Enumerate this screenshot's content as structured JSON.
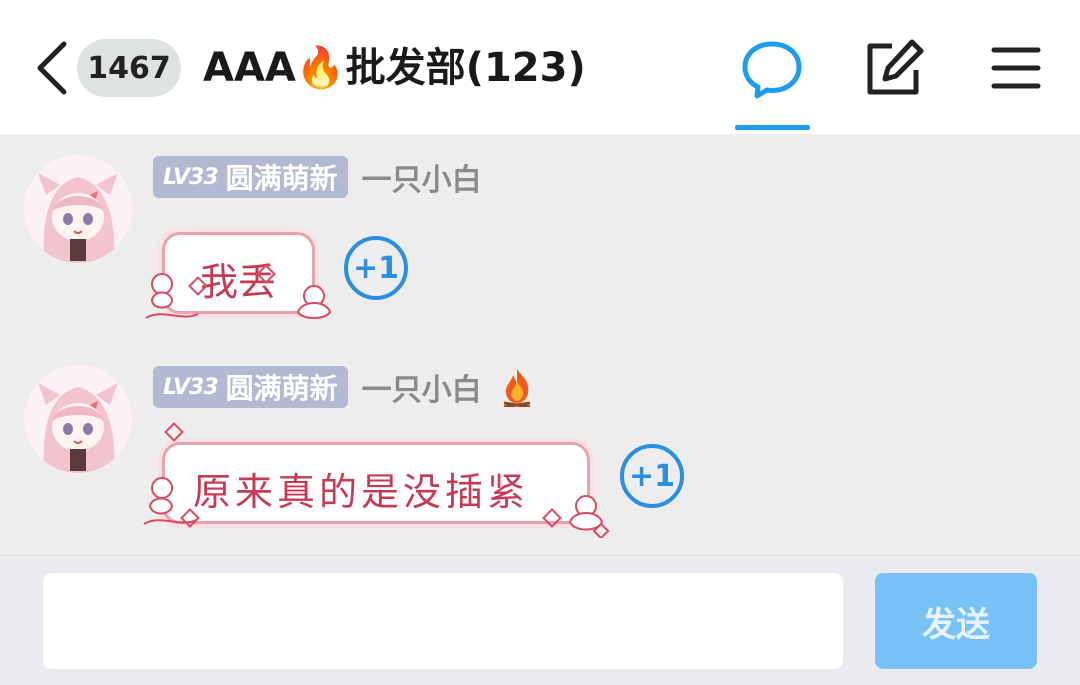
{
  "header": {
    "unread_count": "1467",
    "title": "AAA🔥批发部(123)",
    "icons": [
      "back-chevron-icon",
      "chat-bubble-icon",
      "edit-icon",
      "menu-icon"
    ],
    "active_tab_color": "#1e9cf0"
  },
  "messages": [
    {
      "level": "LV33",
      "rank": "圆满萌新",
      "nickname": "一只小白",
      "has_fire_badge": false,
      "text": "我丢",
      "plus_one": "+1"
    },
    {
      "level": "LV33",
      "rank": "圆满萌新",
      "nickname": "一只小白",
      "has_fire_badge": true,
      "text": "原来真的是没插紧",
      "plus_one": "+1"
    }
  ],
  "composer": {
    "input_value": "",
    "send_label": "发送"
  }
}
